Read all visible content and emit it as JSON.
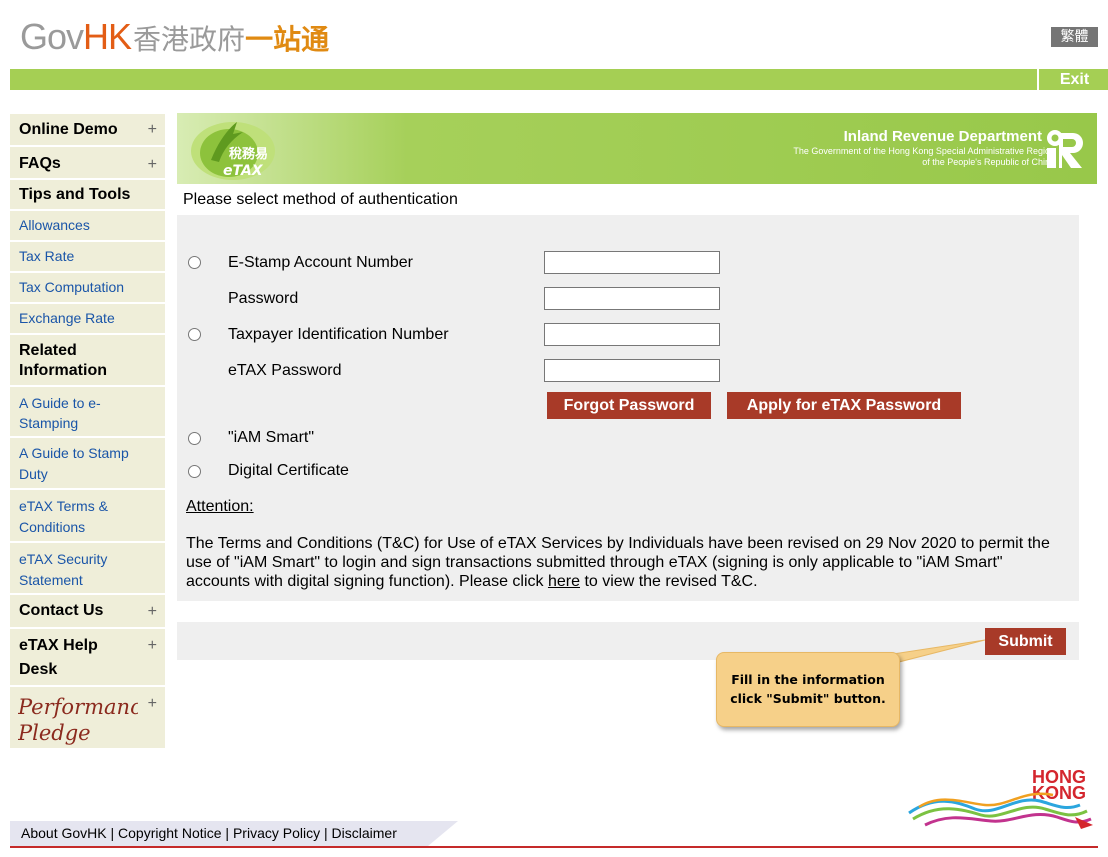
{
  "header": {
    "logo_gov": "Gov",
    "logo_hk": "HK",
    "logo_zh1": "香港政府",
    "logo_zh2": "一站通",
    "lang_label": "繁體",
    "exit_label": "Exit"
  },
  "sidebar": {
    "items": [
      {
        "label": "Online Demo",
        "type": "heading",
        "expandable": true
      },
      {
        "label": "FAQs",
        "type": "heading",
        "expandable": true
      },
      {
        "label": "Tips and Tools",
        "type": "heading",
        "expandable": false
      },
      {
        "label": "Allowances",
        "type": "link"
      },
      {
        "label": "Tax Rate",
        "type": "link"
      },
      {
        "label": "Tax Computation",
        "type": "link"
      },
      {
        "label": "Exchange Rate",
        "type": "link"
      },
      {
        "label": "Related Information",
        "type": "heading",
        "expandable": false
      },
      {
        "label": "A Guide to e-Stamping",
        "type": "link"
      },
      {
        "label": "A Guide to Stamp Duty",
        "type": "link"
      },
      {
        "label": "eTAX Terms & Conditions",
        "type": "link"
      },
      {
        "label": "eTAX Security Statement",
        "type": "link"
      },
      {
        "label": "Contact Us",
        "type": "heading",
        "expandable": true
      },
      {
        "label": "eTAX Help Desk",
        "type": "heading",
        "expandable": true
      },
      {
        "label": "Performance Pledge",
        "type": "logo",
        "expandable": true
      }
    ]
  },
  "banner": {
    "etax_zh": "稅務易",
    "etax_en": "eTAX",
    "dept_name": "Inland Revenue Department",
    "dept_sub1": "The Government of the Hong Kong Special Administrative Region",
    "dept_sub2": "of the People's Republic of China"
  },
  "form": {
    "title": "Please select method of authentication",
    "options": {
      "estamp_label": "E-Stamp Account Number",
      "password_label": "Password",
      "tin_label": "Taxpayer Identification Number",
      "etax_password_label": "eTAX Password",
      "iam_smart_label": "\"iAM Smart\"",
      "digital_cert_label": "Digital Certificate"
    },
    "forgot_password_button": "Forgot Password",
    "apply_password_button": "Apply for eTAX Password",
    "attention_label": "Attention:",
    "note_part1": "The Terms and Conditions (T&C) for Use of eTAX Services by Individuals have been revised on 29 Nov 2020 to permit the use of \"iAM Smart\" to login and sign transactions submitted through eTAX (signing is only applicable to \"iAM Smart\" accounts with digital signing function). Please click ",
    "note_link": "here",
    "note_part2": " to view the revised T&C.",
    "submit_button": "Submit"
  },
  "callout": {
    "line1": "Fill in the information",
    "line2": "click \"Submit\" button."
  },
  "footer": {
    "about": "About GovHK",
    "copyright": "Copyright Notice",
    "privacy": "Privacy Policy",
    "disclaimer": "Disclaimer",
    "separator": "|",
    "brand_line1": "HONG",
    "brand_line2": "KONG"
  },
  "colors": {
    "green_bar": "#a5cf54",
    "button_red": "#a83a28",
    "sidebar_bg": "#efeed9",
    "link_blue": "#1a55a8",
    "panel_bg": "#efefef",
    "callout_bg": "#f6d089"
  }
}
